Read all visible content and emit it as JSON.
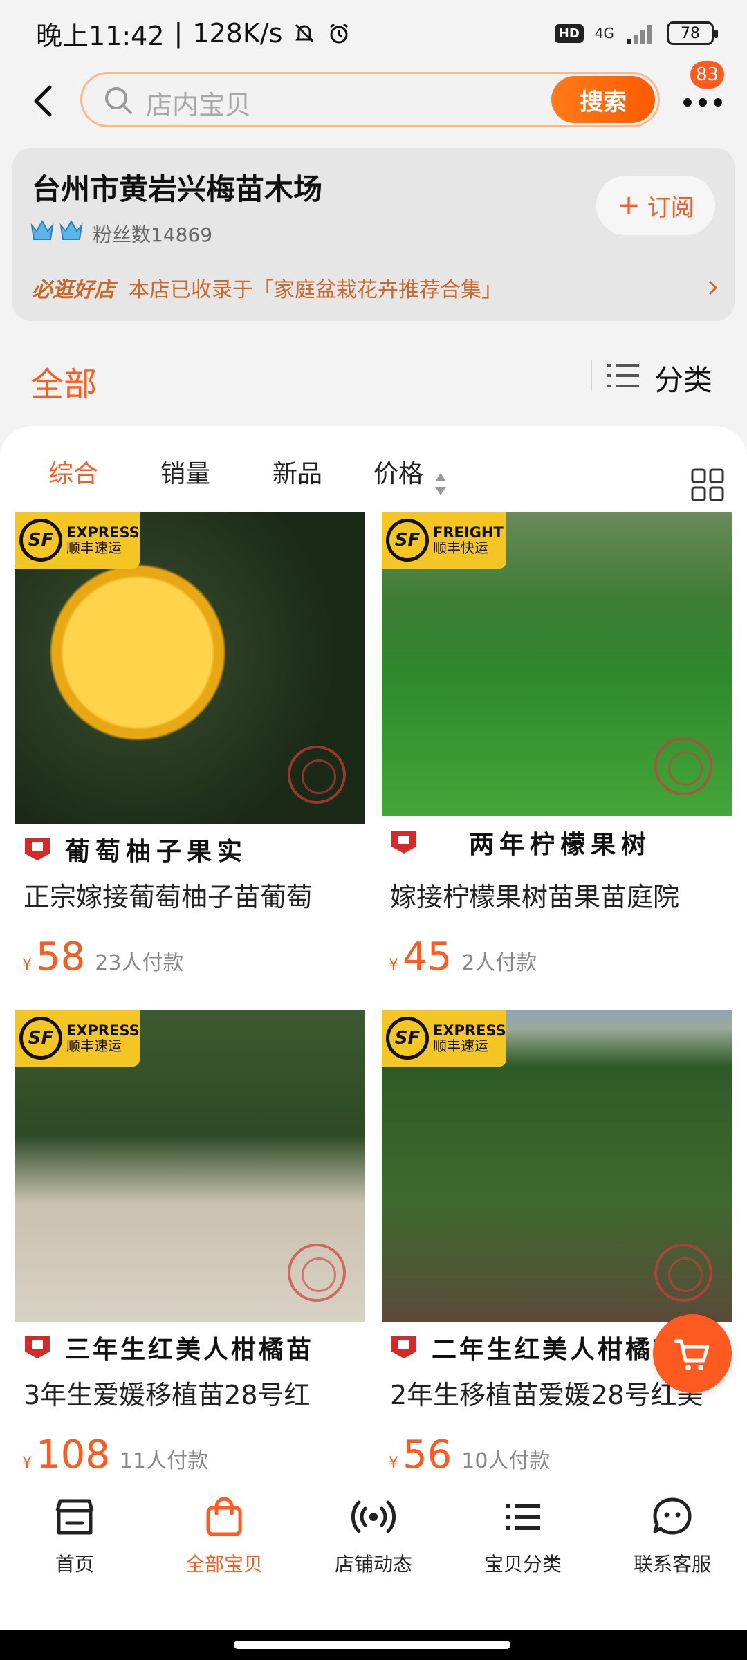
{
  "status_bar": {
    "time": "晚上11:42",
    "speed": "128K/s",
    "hd": "HD",
    "network": "4G",
    "battery": "78"
  },
  "search": {
    "placeholder": "店内宝贝",
    "button": "搜索",
    "notification_count": "83"
  },
  "shop": {
    "name": "台州市黄岩兴梅苗木场",
    "fans": "粉丝数14869",
    "subscribe": "订阅",
    "promo_badge": "必逛好店",
    "promo_text": "本店已收录于「家庭盆栽花卉推荐合集」"
  },
  "filter": {
    "all": "全部",
    "category": "分类"
  },
  "sort_tabs": [
    "综合",
    "销量",
    "新品",
    "价格"
  ],
  "colors": {
    "accent": "#ff5a1f",
    "sf_yellow": "#f4c624"
  },
  "products": [
    {
      "badge_en": "EXPRESS",
      "badge_zh": "顺丰速运",
      "tag": "葡萄柚子果实",
      "title": "正宗嫁接葡萄柚子苗葡萄",
      "currency": "¥",
      "price": "58",
      "paid": "23人付款"
    },
    {
      "badge_en": "FREIGHT",
      "badge_zh": "顺丰快运",
      "tag": "两年柠檬果树",
      "title": "嫁接柠檬果树苗果苗庭院",
      "currency": "¥",
      "price": "45",
      "paid": "2人付款"
    },
    {
      "badge_en": "EXPRESS",
      "badge_zh": "顺丰速运",
      "tag": "三年生红美人柑橘苗",
      "title": "3年生爱媛移植苗28号红",
      "currency": "¥",
      "price": "108",
      "paid": "11人付款"
    },
    {
      "badge_en": "EXPRESS",
      "badge_zh": "顺丰速运",
      "tag": "二年生红美人柑橘苗",
      "title": "2年生移植苗爱媛28号红美",
      "currency": "¥",
      "price": "56",
      "paid": "10人付款"
    }
  ],
  "bottom_nav": [
    "首页",
    "全部宝贝",
    "店铺动态",
    "宝贝分类",
    "联系客服"
  ]
}
